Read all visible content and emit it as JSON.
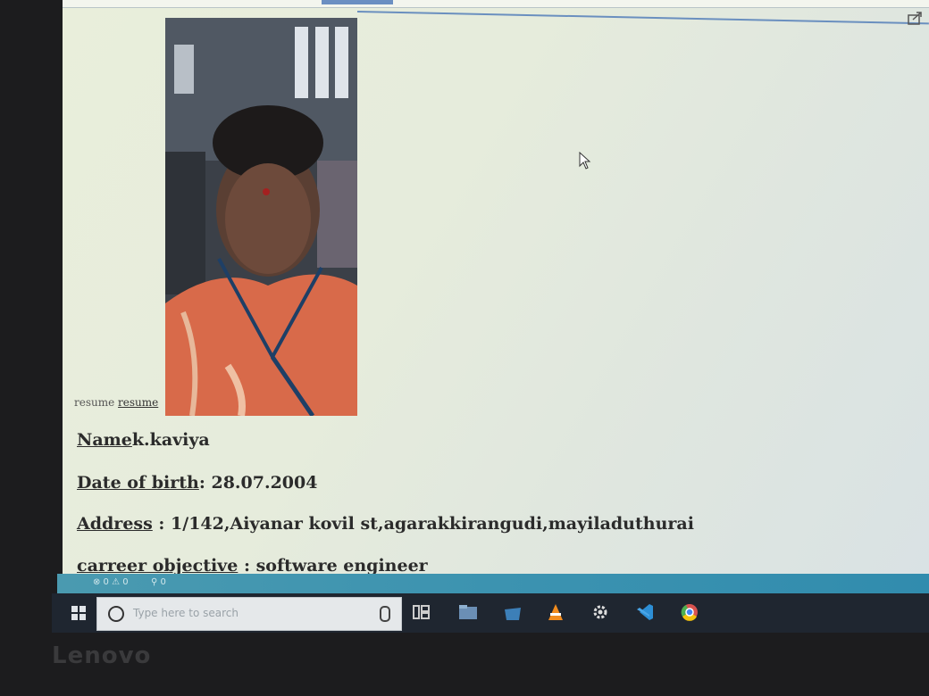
{
  "photo": {
    "alt_text": "resume",
    "alt_link": "resume"
  },
  "info": {
    "name_label": "Name",
    "name_value": "k.kaviya",
    "dob_label": "Date of birth",
    "dob_value": ": 28.07.2004",
    "address_label": "Address",
    "address_value": " : 1/142,Aiyanar kovil st,agarakkirangudi,mayiladuthurai",
    "objective_label": "carreer objective",
    "objective_value": " : software engineer"
  },
  "status_bar": {
    "errors": "⊗ 0 ⚠ 0",
    "ports": "⚲ 0"
  },
  "taskbar": {
    "search_placeholder": "Type here to search"
  },
  "bezel": {
    "brand": "Lenovo"
  },
  "colors": {
    "page_background": "#e6ecdc",
    "status_strip": "#3c93b0",
    "taskbar": "#1f2630"
  },
  "icons": [
    "share-icon",
    "cursor-icon",
    "windows-icon",
    "search-icon",
    "microphone-icon",
    "task-view-icon",
    "file-explorer-icon",
    "store-icon",
    "vlc-icon",
    "settings-icon",
    "vscode-icon",
    "chrome-icon"
  ]
}
